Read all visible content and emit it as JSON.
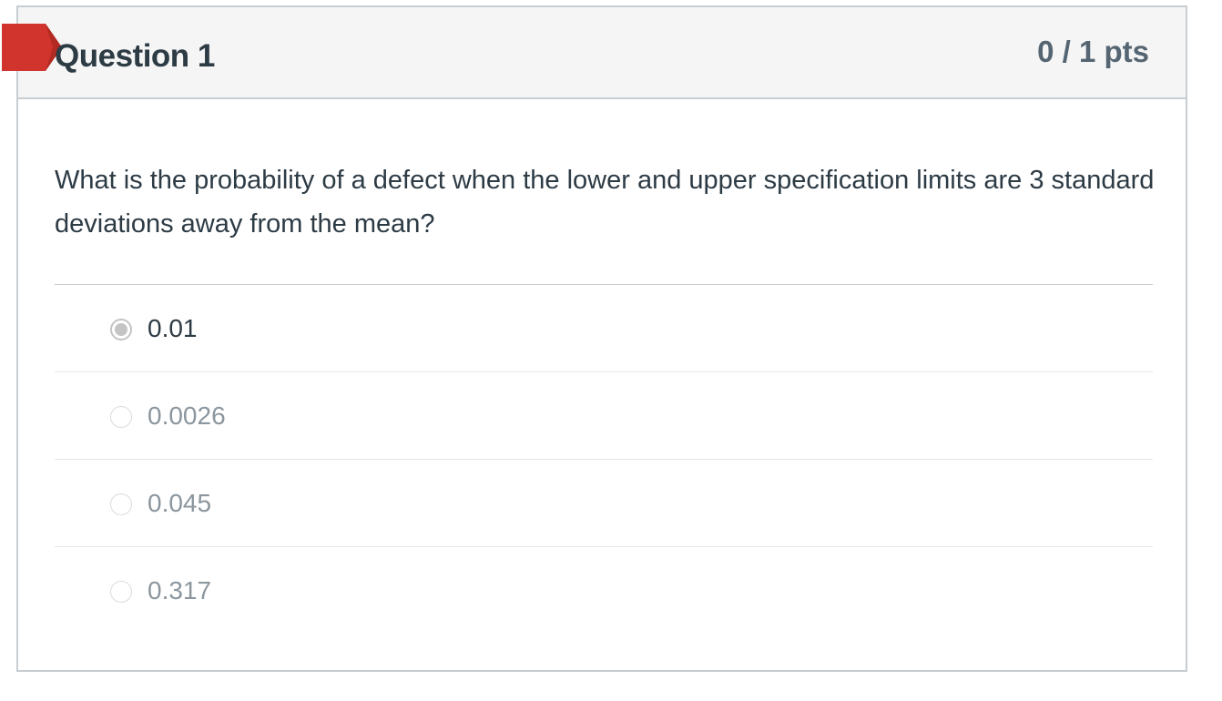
{
  "question": {
    "title": "Question 1",
    "points": "0 / 1 pts",
    "status": "incorrect",
    "flag_color": "#d0342c",
    "text": "What is the probability of a defect when the lower and upper specification limits are 3 standard deviations away from the mean?"
  },
  "answers": [
    {
      "label": "0.01",
      "selected": true
    },
    {
      "label": "0.0026",
      "selected": false
    },
    {
      "label": "0.045",
      "selected": false
    },
    {
      "label": "0.317",
      "selected": false
    }
  ],
  "icons": {
    "flag": "incorrect-answer-flag-icon",
    "radio": "radio-button-icon"
  }
}
